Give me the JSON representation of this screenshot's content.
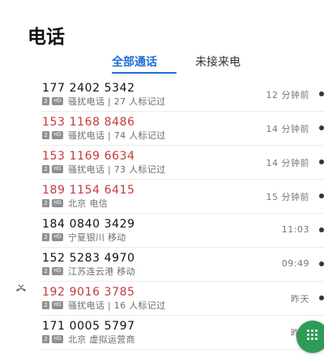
{
  "header": {
    "title": "电话"
  },
  "tabs": [
    {
      "label": "全部通话",
      "active": true
    },
    {
      "label": "未接来电",
      "active": false
    }
  ],
  "calls": [
    {
      "number": "177 2402 5342",
      "sim": "2",
      "hd": "HD",
      "detail": "骚扰电话 | 27 人标记过",
      "time": "12 分钟前",
      "missed": false
    },
    {
      "number": "153 1168 8486",
      "sim": "2",
      "hd": "HD",
      "detail": "骚扰电话 | 74 人标记过",
      "time": "14 分钟前",
      "missed": true
    },
    {
      "number": "153 1169 6634",
      "sim": "2",
      "hd": "HD",
      "detail": "骚扰电话 | 73 人标记过",
      "time": "14 分钟前",
      "missed": true
    },
    {
      "number": "189 1154 6415",
      "sim": "2",
      "hd": "HD",
      "detail": "北京 电信",
      "time": "15 分钟前",
      "missed": true
    },
    {
      "number": "184 0840 3429",
      "sim": "2",
      "hd": "HD",
      "detail": "宁夏银川 移动",
      "time": "11:03",
      "missed": false
    },
    {
      "number": "152 5283 4970",
      "sim": "2",
      "hd": "HD",
      "detail": "江苏连云港 移动",
      "time": "09:49",
      "missed": false
    },
    {
      "number": "192 9016 3785",
      "sim": "2",
      "hd": "HD",
      "detail": "骚扰电话 | 16 人标记过",
      "time": "昨天",
      "missed": true
    },
    {
      "number": "171 0005 5797",
      "sim": "2",
      "hd": "HD",
      "detail": "北京 虚拟运营商",
      "time": "昨天",
      "missed": false
    }
  ],
  "colors": {
    "accent": "#1d6fd6",
    "missed": "#c8383a",
    "fab": "#2e9b57"
  },
  "icons": {
    "missed_call": "missed-call-icon",
    "dialpad": "dialpad-icon",
    "info": "info-icon"
  }
}
